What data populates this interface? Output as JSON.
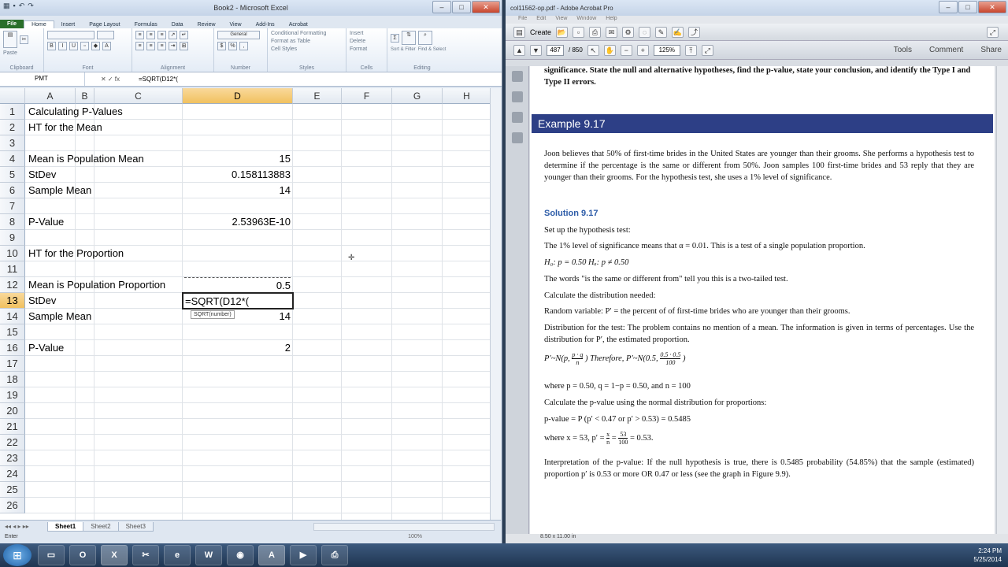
{
  "excel": {
    "title": "Book2 - Microsoft Excel",
    "tabs": [
      "File",
      "Home",
      "Insert",
      "Page Layout",
      "Formulas",
      "Data",
      "Review",
      "View",
      "Add-Ins",
      "Acrobat"
    ],
    "groups": [
      "Clipboard",
      "Font",
      "Alignment",
      "Number",
      "Styles",
      "Cells",
      "Editing"
    ],
    "ribbon": {
      "paste": "Paste",
      "number_format": "General",
      "cond_fmt": "Conditional Formatting",
      "format_table": "Format as Table",
      "cell_styles": "Cell Styles",
      "insert": "Insert",
      "delete": "Delete",
      "format": "Format",
      "sort": "Sort & Filter",
      "find": "Find & Select"
    },
    "name_box": "PMT",
    "formula_bar": "=SQRT(D12*(",
    "columns": [
      "A",
      "B",
      "C",
      "D",
      "E",
      "F",
      "G",
      "H"
    ],
    "rows": [
      "1",
      "2",
      "3",
      "4",
      "5",
      "6",
      "7",
      "8",
      "9",
      "10",
      "11",
      "12",
      "13",
      "14",
      "15",
      "16",
      "17",
      "18",
      "19",
      "20",
      "21",
      "22",
      "23",
      "24",
      "25",
      "26"
    ],
    "labels": {
      "r1": "Calculating P-Values",
      "r2": "HT for the Mean",
      "r4": "Mean is Population Mean",
      "r5": "StDev",
      "r6": "Sample Mean",
      "r8": "P-Value",
      "r10": "HT for the Proportion",
      "r12": "Mean is Population Proportion",
      "r13": "StDev",
      "r14": "Sample Mean",
      "r16": "P-Value"
    },
    "values": {
      "d4": "15",
      "d5": "0.158113883",
      "d6": "14",
      "d8": "2.53963E-10",
      "d12": "0.5",
      "d13": "=SQRT(D12*(",
      "d14": "14",
      "d16": "2"
    },
    "tooltip": "SQRT(number)",
    "sheet_tabs": [
      "Sheet1",
      "Sheet2",
      "Sheet3"
    ],
    "status": "Enter",
    "zoom": "100%"
  },
  "pdf": {
    "title": "col11562-op.pdf - Adobe Acrobat Pro",
    "menu": [
      "File",
      "Edit",
      "View",
      "Window",
      "Help"
    ],
    "create_label": "Create",
    "page_current": "487",
    "page_total": "/ 850",
    "zoom": "125%",
    "links": [
      "Tools",
      "Comment",
      "Share"
    ],
    "top_text": "significance. State the null and alternative hypotheses, find the p-value, state your conclusion, and identify the Type I and Type II errors.",
    "example_title": "Example 9.17",
    "para1": "Joon believes that 50% of first-time brides in the United States are younger than their grooms. She performs a hypothesis test to determine if the percentage is the same or different from 50%. Joon samples 100 first-time brides and 53 reply that they are younger than their grooms. For the hypothesis test, she uses a 1% level of significance.",
    "solution": "Solution 9.17",
    "l1": "Set up the hypothesis test:",
    "l2": "The 1% level of significance means that α = 0.01. This is a test of a single population proportion.",
    "l3": "H₀: p = 0.50        Hₐ: p ≠ 0.50",
    "l4": "The words \"is the same or different from\" tell you this is a two-tailed test.",
    "l5": "Calculate the distribution needed:",
    "l6": "Random variable: P′ = the percent of of first-time brides who are younger than their grooms.",
    "l7": "Distribution for the test: The problem contains no mention of a mean. The information is given in terms of percentages. Use the distribution for P′, the estimated proportion.",
    "f1": "P′~N(p,",
    "f1n": "p · q",
    "f1d": "n",
    "f1b": ")  Therefore,  P′~N(0.5,",
    "f2n": "0.5 · 0.5",
    "f2d": "100",
    "f_end": ")",
    "l8": "where p = 0.50, q = 1−p = 0.50, and n = 100",
    "l9": "Calculate the p-value using the normal distribution for proportions:",
    "l10": "p-value = P (p′ < 0.47 or p′ > 0.53) = 0.5485",
    "l11a": "where x = 53, p′ =",
    "l11n1": "x",
    "l11d1": "n",
    "l11m": "=",
    "l11n2": "53",
    "l11d2": "100",
    "l11e": "= 0.53.",
    "l12": "Interpretation of the p-value: If the null hypothesis is true, there is 0.5485 probability (54.85%) that the sample (estimated) proportion p′ is 0.53 or more OR 0.47 or less (see the graph in Figure 9.9).",
    "page_size": "8.50 x 11.00 in"
  },
  "taskbar": {
    "time": "2:24 PM",
    "date": "5/25/2014"
  }
}
